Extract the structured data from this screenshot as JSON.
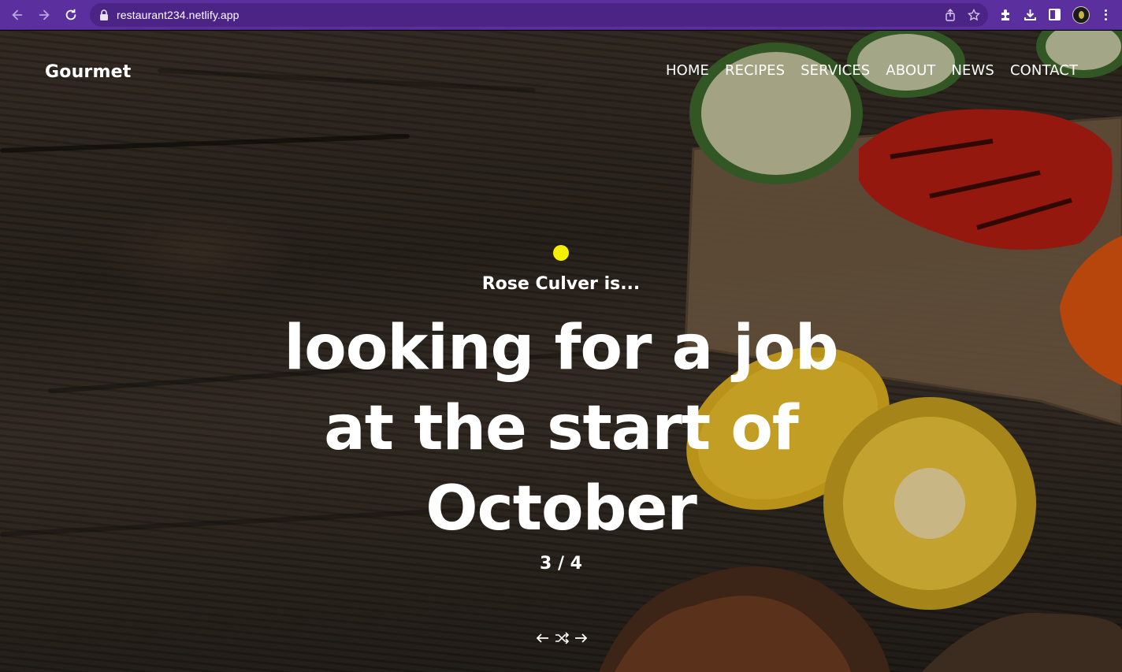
{
  "browser": {
    "url": "restaurant234.netlify.app",
    "icons": [
      "back-icon",
      "forward-icon",
      "reload-icon",
      "lock-icon",
      "share-icon",
      "bookmark-star-icon",
      "extensions-icon",
      "download-icon",
      "sidepanel-icon",
      "profile-avatar",
      "menu-icon"
    ]
  },
  "site": {
    "brand": "Gourmet",
    "nav": [
      "HOME",
      "RECIPES",
      "SERVICES",
      "ABOUT",
      "NEWS",
      "CONTACT"
    ]
  },
  "hero": {
    "lead": "Rose Culver is...",
    "headline": "looking for a job at the start of October",
    "counter": "3 / 4",
    "accent_color": "#f6f000",
    "controls": [
      "arrow-left-icon",
      "shuffle-icon",
      "arrow-right-icon"
    ]
  }
}
